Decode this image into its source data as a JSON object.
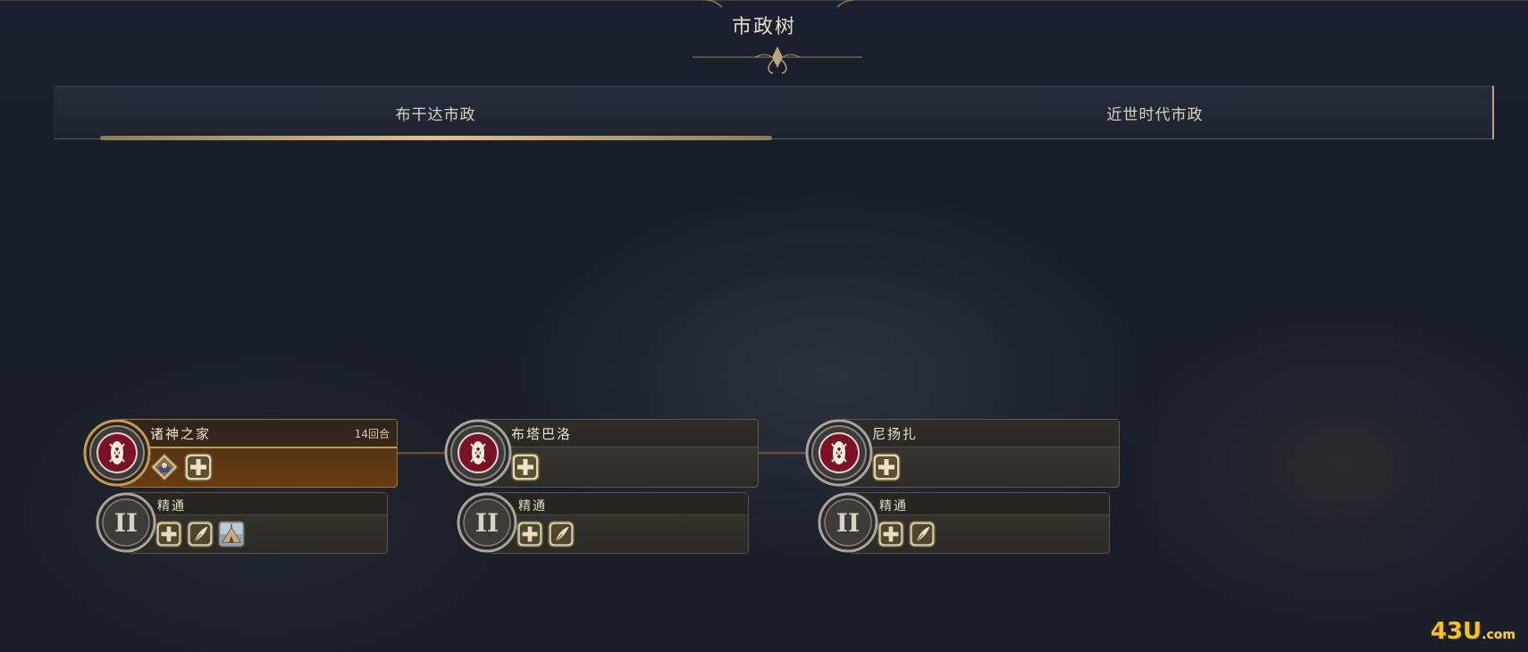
{
  "header": {
    "title": "市政树"
  },
  "tabs": [
    {
      "label": "布干达市政",
      "selected": true
    },
    {
      "label": "近世时代市政",
      "selected": false
    }
  ],
  "civics": [
    {
      "name": "诸神之家",
      "turns": "14回合",
      "active": true,
      "icons": [
        "diamond-unit-icon",
        "plus-icon"
      ],
      "mastery": {
        "name": "精通",
        "numeral": "II",
        "icons": [
          "plus-icon",
          "quill-icon",
          "tent-icon"
        ]
      }
    },
    {
      "name": "布塔巴洛",
      "turns": "",
      "active": false,
      "icons": [
        "plus-icon"
      ],
      "mastery": {
        "name": "精通",
        "numeral": "II",
        "icons": [
          "plus-icon",
          "quill-icon"
        ]
      }
    },
    {
      "name": "尼扬扎",
      "turns": "",
      "active": false,
      "icons": [
        "plus-icon"
      ],
      "mastery": {
        "name": "精通",
        "numeral": "II",
        "icons": [
          "plus-icon",
          "quill-icon"
        ]
      }
    }
  ],
  "watermark": {
    "main": "43U",
    "suffix": ".com"
  },
  "colors": {
    "accent_gold": "#c59a49",
    "active_card": "#5a3514",
    "shield_red": "#a01830"
  }
}
